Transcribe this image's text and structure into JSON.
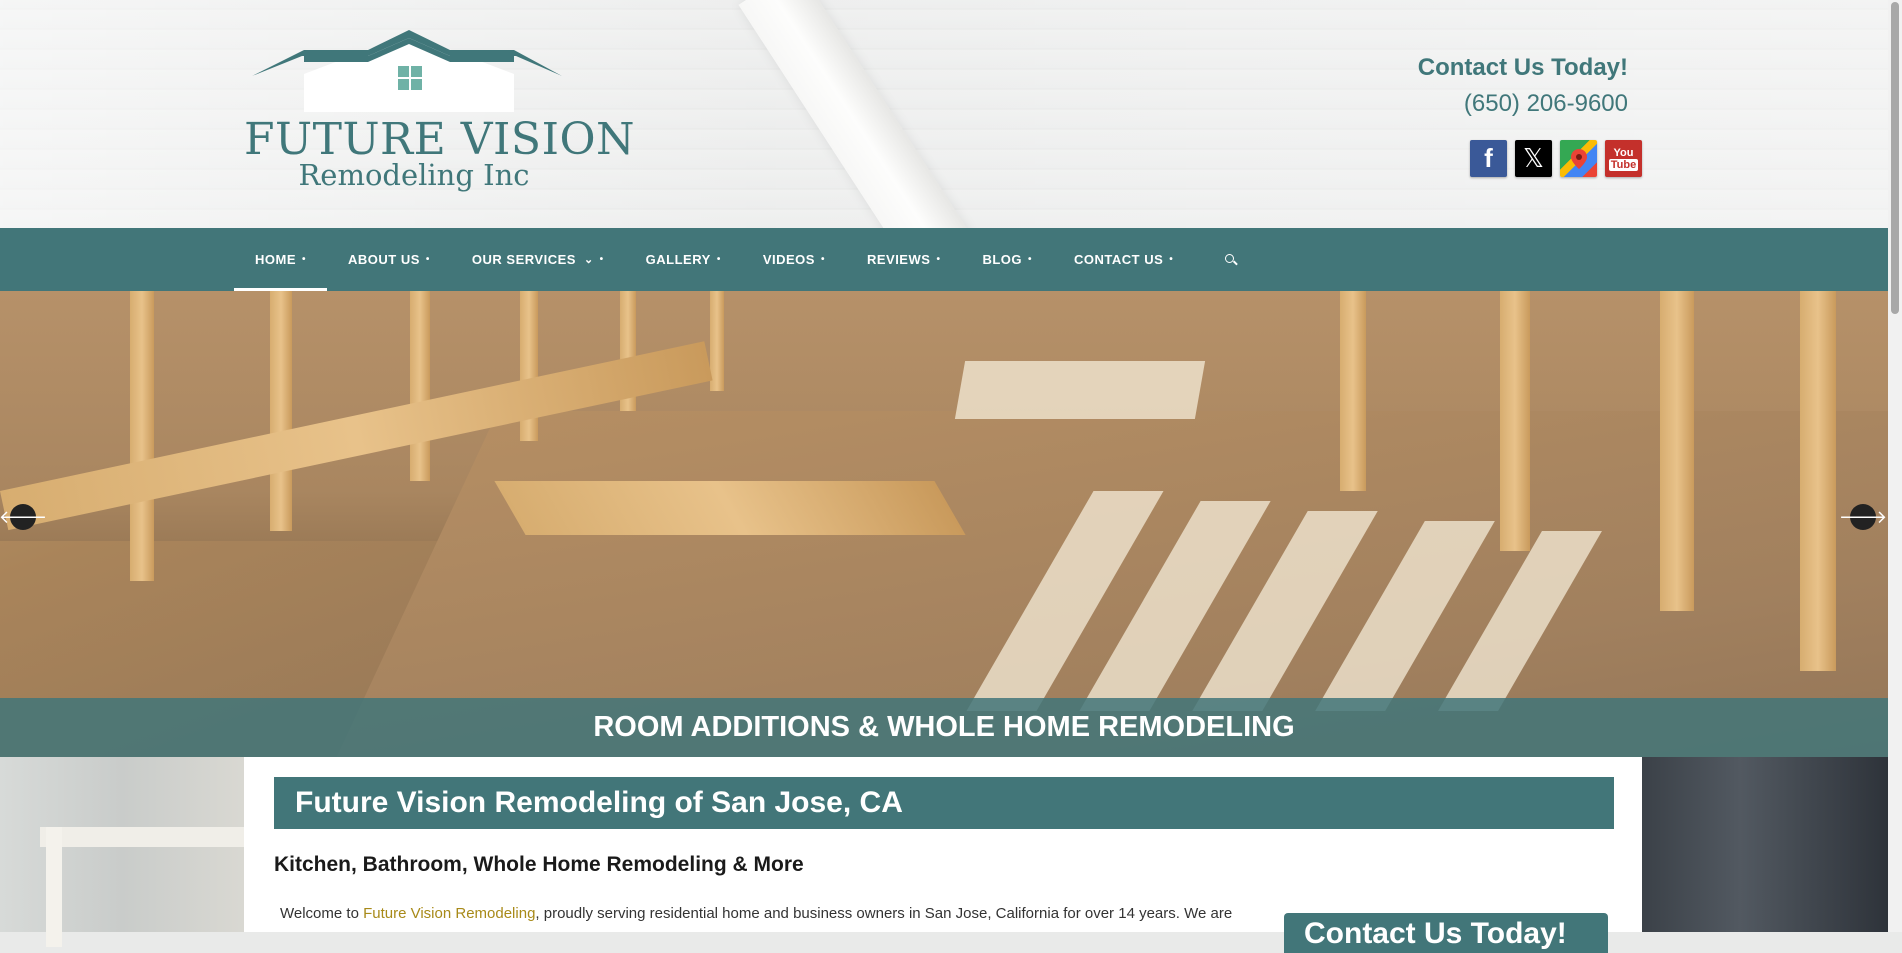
{
  "brand": {
    "name_line1": "FUTURE VISION",
    "name_line2": "Remodeling Inc"
  },
  "contact": {
    "title": "Contact Us Today!",
    "phone": "(650) 206-9600"
  },
  "social": [
    {
      "name": "facebook",
      "glyph": "f",
      "color": "#3a5998"
    },
    {
      "name": "x-twitter",
      "glyph": "𝕏",
      "color": "#000000"
    },
    {
      "name": "google-maps",
      "glyph": "",
      "color": "#34a853"
    },
    {
      "name": "youtube",
      "glyph_top": "You",
      "glyph_bottom": "Tube",
      "color": "#c4302b"
    }
  ],
  "nav": {
    "items": [
      {
        "label": "HOME",
        "active": true
      },
      {
        "label": "ABOUT US"
      },
      {
        "label": "OUR SERVICES",
        "has_dropdown": true
      },
      {
        "label": "GALLERY"
      },
      {
        "label": "VIDEOS"
      },
      {
        "label": "REVIEWS"
      },
      {
        "label": "BLOG"
      },
      {
        "label": "CONTACT US"
      }
    ],
    "dot": "•",
    "chevron": "⌄"
  },
  "hero": {
    "caption": "ROOM ADDITIONS & WHOLE HOME REMODELING",
    "prev": "🡐",
    "next": "🡒"
  },
  "content": {
    "title": "Future Vision Remodeling of San Jose, CA",
    "subtitle": "Kitchen, Bathroom, Whole Home Remodeling & More",
    "intro_prefix": "Welcome to ",
    "intro_link": "Future Vision Remodeling",
    "intro_suffix": ", proudly serving residential home and business owners in San Jose, California for over 14 years. We are",
    "side_box_title": "Contact Us Today!"
  },
  "colors": {
    "brand_teal": "#427679",
    "link_gold": "#a88a19"
  }
}
